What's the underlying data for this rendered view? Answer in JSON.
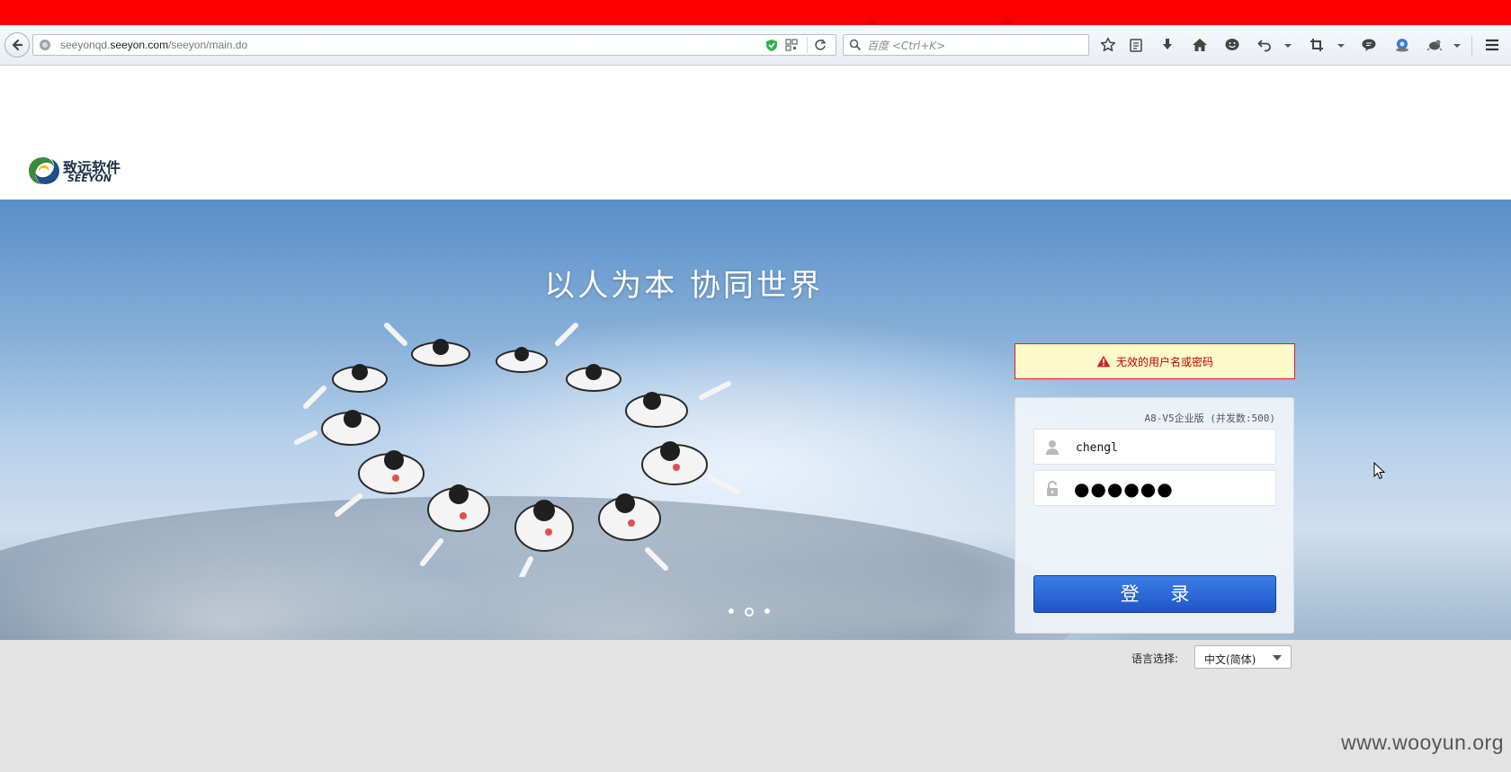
{
  "browser": {
    "url_prefix": "seeyonqd.",
    "url_domain": "seeyon.com",
    "url_path": "/seeyon/main.do",
    "search_placeholder": "百度 <Ctrl+K>"
  },
  "header": {
    "logo_cn": "致远软件",
    "logo_en": "SEEYON"
  },
  "banner": {
    "slogan": "以人为本  协同世界",
    "slides": 3,
    "active_slide": 2
  },
  "error": {
    "message": "无效的用户名或密码"
  },
  "login": {
    "edition": "A8-V5企业版 (并发数:500)",
    "username": "chengl",
    "password_mask": "●●●●●●",
    "submit_label": "登 录"
  },
  "language": {
    "label": "语言选择:",
    "selected": "中文(简体)"
  },
  "watermark": "www.wooyun.org",
  "colors": {
    "accent": "#2563d6",
    "error_text": "#c00000",
    "error_bg": "#fdf9c8",
    "top_bar": "#ff0000"
  }
}
